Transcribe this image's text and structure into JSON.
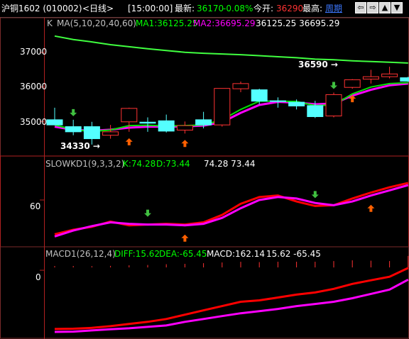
{
  "window": {
    "instrument": "沪铜1602 (010002)",
    "period_tag": "<日线>",
    "time": "[15:00:00]",
    "latest_label": "最新:",
    "latest_value": "36170",
    "change_pct": "-0.08%",
    "open_label": "今开:",
    "open_value": "36290",
    "high_label": "最高:",
    "period_link": "周期",
    "nav_buttons": [
      "⇦",
      "⇨",
      "▲",
      "▼",
      "⤢"
    ]
  },
  "price_panel": {
    "header": {
      "k": "K",
      "ma_params": "MA(5,10,20,40,60)",
      "ma1": "MA1:36125.25",
      "ma2": "MA2:36695.29",
      "extra": "36125.25 36695.29"
    },
    "y_ticks": [
      "37000",
      "36000",
      "35000"
    ],
    "annotations": {
      "high": "36590 →",
      "low": "34330 →"
    }
  },
  "kd_panel": {
    "header": {
      "name": "SLOWKD1(9,3,3,2)",
      "k": "K:74.28",
      "d": "D:73.44",
      "extra": "74.28 73.44"
    },
    "y_ticks": [
      "60"
    ]
  },
  "macd_panel": {
    "header": {
      "name": "MACD1(26,12,4)",
      "diff": "DIFF:15.62",
      "dea": "DEA:-65.45",
      "macd": "MACD:162.14",
      "extra": "15.62 -65.45"
    },
    "y_ticks": [
      "0"
    ]
  },
  "colors": {
    "up": "#ff3232",
    "down": "#54ffff",
    "ma1": "#00e000",
    "ma2": "#ff00ff",
    "ma_long": "#40ff40",
    "kd_k": "#ff0000",
    "kd_d": "#ff00ff",
    "macd_diff": "#ff0000",
    "macd_dea": "#ff00ff",
    "signal_buy": "#ff6000",
    "signal_sell": "#40c040"
  },
  "chart_data": {
    "candles": [
      {
        "o": 35050,
        "h": 35400,
        "l": 34900,
        "c": 34900
      },
      {
        "o": 34850,
        "h": 35050,
        "l": 34600,
        "c": 34700
      },
      {
        "o": 34850,
        "h": 34990,
        "l": 34330,
        "c": 34500
      },
      {
        "o": 34600,
        "h": 34900,
        "l": 34500,
        "c": 34700
      },
      {
        "o": 34990,
        "h": 35400,
        "l": 34700,
        "c": 35380
      },
      {
        "o": 34980,
        "h": 35120,
        "l": 34700,
        "c": 34950
      },
      {
        "o": 35020,
        "h": 35200,
        "l": 34680,
        "c": 34720
      },
      {
        "o": 34750,
        "h": 35000,
        "l": 34650,
        "c": 34880
      },
      {
        "o": 35050,
        "h": 35280,
        "l": 34800,
        "c": 34900
      },
      {
        "o": 34900,
        "h": 35900,
        "l": 34850,
        "c": 35960
      },
      {
        "o": 35950,
        "h": 36160,
        "l": 35850,
        "c": 36100
      },
      {
        "o": 35920,
        "h": 35950,
        "l": 35500,
        "c": 35590
      },
      {
        "o": 35600,
        "h": 35700,
        "l": 35400,
        "c": 35580
      },
      {
        "o": 35560,
        "h": 35640,
        "l": 35350,
        "c": 35450
      },
      {
        "o": 35460,
        "h": 35600,
        "l": 35100,
        "c": 35140
      },
      {
        "o": 35160,
        "h": 35840,
        "l": 35120,
        "c": 35780
      },
      {
        "o": 35990,
        "h": 36230,
        "l": 35950,
        "c": 36210
      },
      {
        "o": 36230,
        "h": 36500,
        "l": 36100,
        "c": 36300
      },
      {
        "o": 36300,
        "h": 36590,
        "l": 36250,
        "c": 36380
      },
      {
        "o": 36270,
        "h": 36300,
        "l": 36150,
        "c": 36170
      }
    ],
    "ma1": [
      34900,
      34760,
      34710,
      34750,
      34880,
      34890,
      34870,
      34880,
      34900,
      35050,
      35350,
      35590,
      35590,
      35580,
      35460,
      35480,
      35800,
      36000,
      36100,
      36125.25
    ],
    "ma2": [
      34850,
      34760,
      34730,
      34760,
      34820,
      34850,
      34850,
      34860,
      34880,
      34980,
      35250,
      35480,
      35570,
      35550,
      35500,
      35520,
      35750,
      35920,
      36050,
      36100
    ],
    "ma_long": [
      37480,
      37380,
      37310,
      37230,
      37170,
      37110,
      37060,
      37010,
      36980,
      36960,
      36940,
      36910,
      36880,
      36850,
      36810,
      36790,
      36760,
      36740,
      36720,
      36695.29
    ],
    "price_range": [
      34100,
      37600
    ],
    "price_ticks": [
      37000,
      36000,
      35000
    ],
    "kd_k": [
      14,
      20,
      24,
      31,
      26,
      27,
      28,
      27,
      30,
      40,
      55,
      64,
      66,
      58,
      52,
      53,
      62,
      70,
      77,
      83
    ],
    "kd_d": [
      11,
      19,
      25,
      30,
      28,
      27,
      27,
      26,
      28,
      36,
      49,
      60,
      64,
      62,
      56,
      53,
      58,
      66,
      73,
      80
    ],
    "kd_range": [
      0,
      100
    ],
    "kd_ticks": [
      60
    ],
    "macd_diff": [
      -410,
      -408,
      -402,
      -390,
      -375,
      -360,
      -340,
      -310,
      -280,
      -250,
      -220,
      -210,
      -190,
      -170,
      -155,
      -130,
      -95,
      -70,
      -45,
      15.62
    ],
    "macd_dea": [
      -430,
      -428,
      -420,
      -412,
      -405,
      -395,
      -385,
      -360,
      -340,
      -320,
      -300,
      -285,
      -270,
      -250,
      -235,
      -220,
      -195,
      -165,
      -135,
      -65.45
    ],
    "macd_bars": [
      20,
      20,
      18,
      22,
      30,
      35,
      45,
      50,
      60,
      70,
      80,
      75,
      80,
      80,
      80,
      90,
      100,
      95,
      90,
      162.14
    ],
    "macd_range": [
      -450,
      30
    ],
    "macd_ticks": [
      0
    ],
    "signals_buy_price": [
      4,
      7,
      16
    ],
    "signals_sell_price": [
      1,
      15
    ],
    "signals_buy_kd": [
      7,
      17
    ],
    "signals_sell_kd": [
      5,
      14
    ]
  }
}
